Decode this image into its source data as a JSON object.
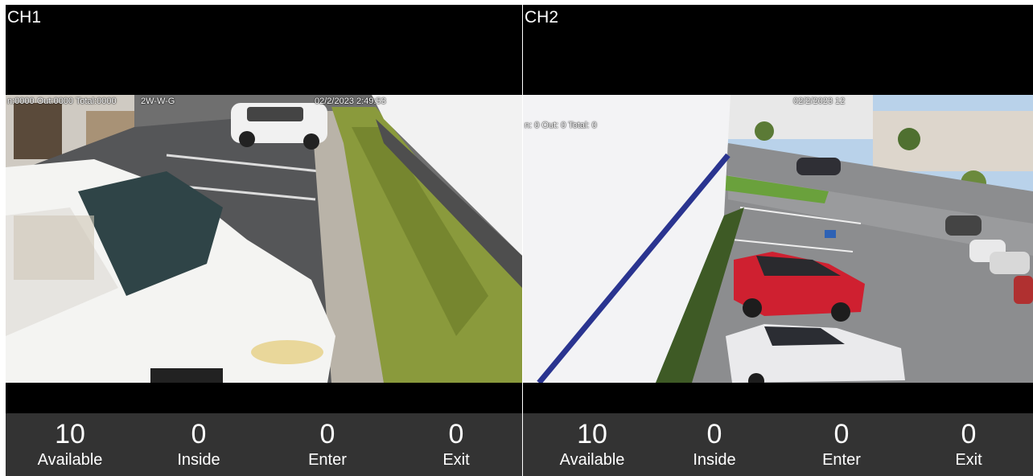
{
  "channels": [
    {
      "label": "CH1",
      "osd_counter": "n:0000 Out:0000 Total:0000",
      "osd_name": "2W-W-G",
      "osd_datetime": "02/2/2023  2:49:53",
      "stats": [
        {
          "value": "10",
          "label": "Available"
        },
        {
          "value": "0",
          "label": "Inside"
        },
        {
          "value": "0",
          "label": "Enter"
        },
        {
          "value": "0",
          "label": "Exit"
        }
      ]
    },
    {
      "label": "CH2",
      "osd_counter": "n:  0  Out:  0  Total:  0",
      "osd_datetime": "02/2/2023  12",
      "stats": [
        {
          "value": "10",
          "label": "Available"
        },
        {
          "value": "0",
          "label": "Inside"
        },
        {
          "value": "0",
          "label": "Enter"
        },
        {
          "value": "0",
          "label": "Exit"
        }
      ]
    }
  ]
}
